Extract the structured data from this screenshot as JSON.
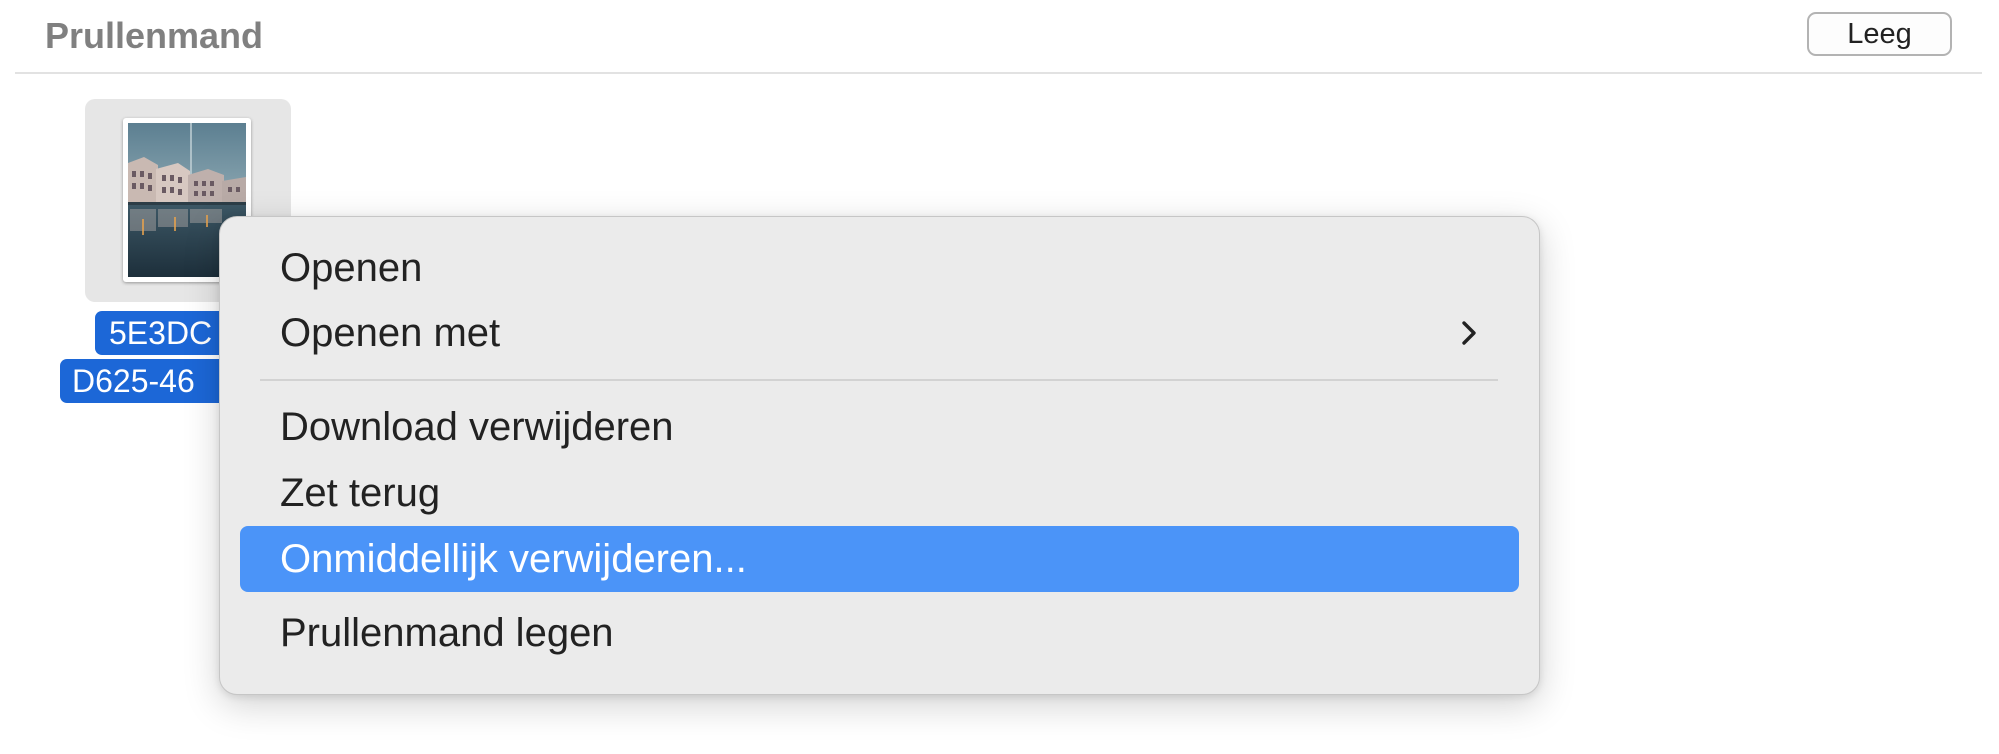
{
  "window": {
    "title": "Prullenmand",
    "empty_button": "Leeg"
  },
  "file": {
    "name_line1": "5E3DC",
    "name_line2": "D625-46",
    "thumbnail_icon": "photo-thumbnail"
  },
  "context_menu": {
    "items": [
      {
        "label": "Openen"
      },
      {
        "label": "Openen met",
        "submenu_icon": "chevron-right-icon"
      },
      {
        "label": "Download verwijderen"
      },
      {
        "label": "Zet terug"
      },
      {
        "label": "Onmiddellijk verwijderen...",
        "highlighted": true
      },
      {
        "label": "Prullenmand legen"
      }
    ],
    "highlight_color": "#4B94F8"
  },
  "colors": {
    "selection": "#1C67D7",
    "title": "#808080"
  }
}
